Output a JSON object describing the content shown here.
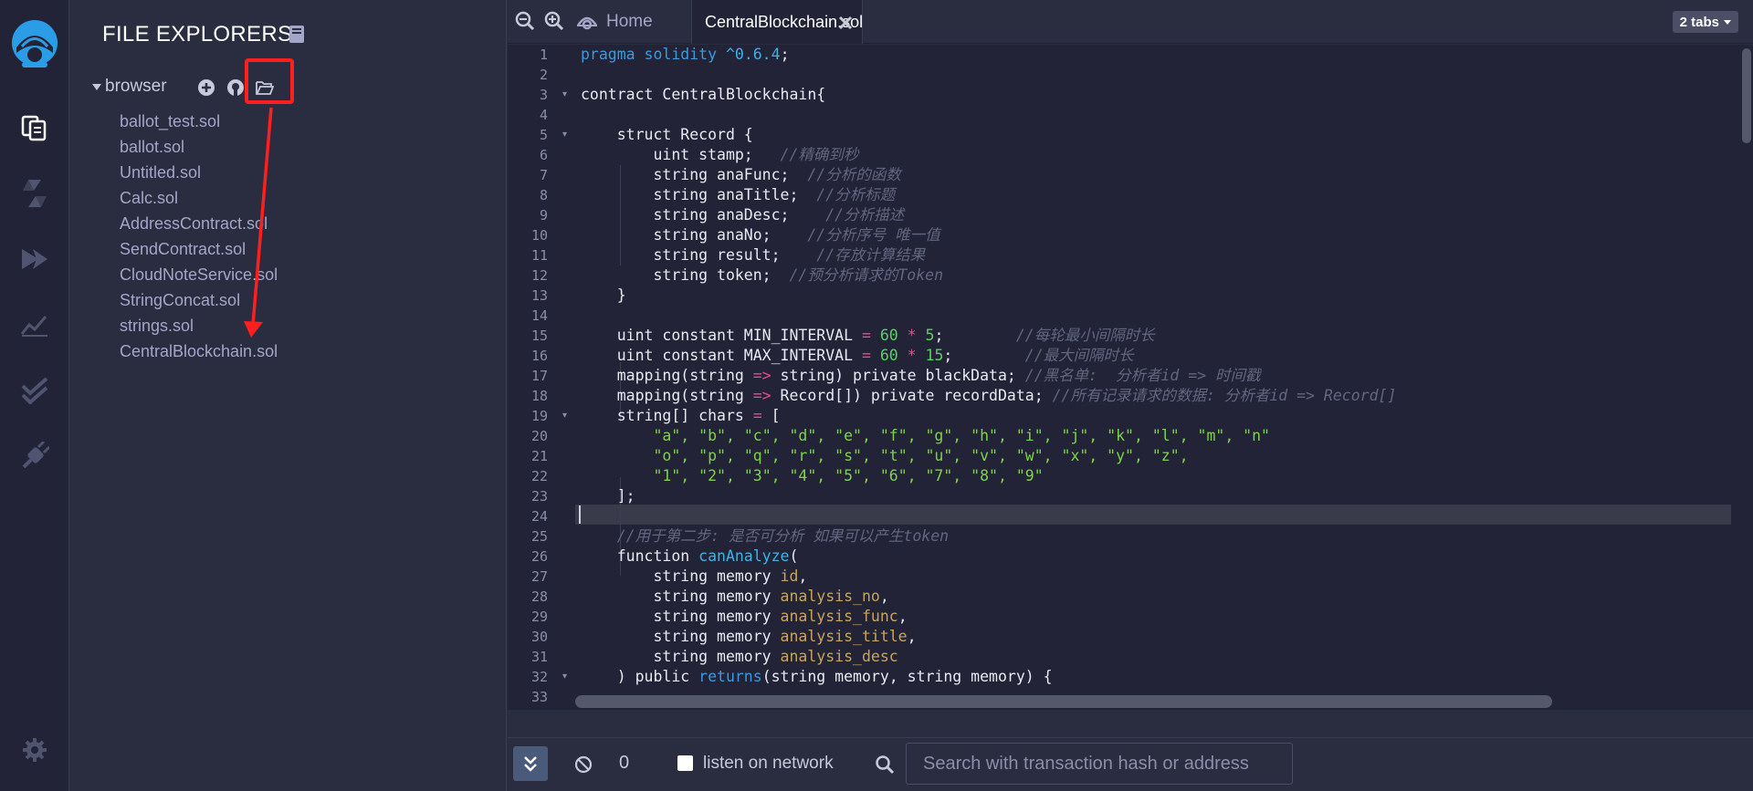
{
  "sidebar": {
    "title": "FILE EXPLORERS",
    "root_folder": "browser",
    "files": [
      "ballot_test.sol",
      "ballot.sol",
      "Untitled.sol",
      "Calc.sol",
      "AddressContract.sol",
      "SendContract.sol",
      "CloudNoteService.sol",
      "StringConcat.sol",
      "strings.sol",
      "CentralBlockchain.sol"
    ]
  },
  "tabs": {
    "home_label": "Home",
    "active_tab": "CentralBlockchain.sol",
    "tabs_count": "2 tabs"
  },
  "editor": {
    "line_numbers": [
      "1",
      "2",
      "3",
      "4",
      "5",
      "6",
      "7",
      "8",
      "9",
      "10",
      "11",
      "12",
      "13",
      "14",
      "15",
      "16",
      "17",
      "18",
      "19",
      "20",
      "21",
      "22",
      "23",
      "24",
      "25",
      "26",
      "27",
      "28",
      "29",
      "30",
      "31",
      "32",
      "33"
    ],
    "code": {
      "l1_kw": "pragma solidity",
      "l1_ver": " ^0.6.4",
      "l1_end": ";",
      "l3": "contract CentralBlockchain{",
      "l5": "    struct Record {",
      "l6_code": "        uint stamp;   ",
      "l6_cmt": "//精确到秒",
      "l7_code": "        string anaFunc;  ",
      "l7_cmt": "//分析的函数",
      "l8_code": "        string anaTitle;  ",
      "l8_cmt": "//分析标题",
      "l9_code": "        string anaDesc;    ",
      "l9_cmt": "//分析描述",
      "l10_code": "        string anaNo;    ",
      "l10_cmt": "//分析序号 唯一值",
      "l11_code": "        string result;    ",
      "l11_cmt": "//存放计算结果",
      "l12_code": "        string token;  ",
      "l12_cmt": "//预分析请求的Token",
      "l13": "    }",
      "l15_a": "    uint constant MIN_INTERVAL ",
      "l15_op1": "=",
      "l15_sp1": " ",
      "l15_n1": "60",
      "l15_sp2": " ",
      "l15_op2": "*",
      "l15_sp3": " ",
      "l15_n2": "5",
      "l15_b": ";        ",
      "l15_cmt": "//每轮最小间隔时长",
      "l16_a": "    uint constant MAX_INTERVAL ",
      "l16_op1": "=",
      "l16_sp1": " ",
      "l16_n1": "60",
      "l16_sp2": " ",
      "l16_op2": "*",
      "l16_sp3": " ",
      "l16_n2": "15",
      "l16_b": ";        ",
      "l16_cmt": "//最大间隔时长",
      "l17_a": "    mapping(string ",
      "l17_op": "=>",
      "l17_b": " string) private blackData; ",
      "l17_cmt": "//黑名单:  分析者id => 时间戳",
      "l18_a": "    mapping(string ",
      "l18_op": "=>",
      "l18_b": " Record[]) private recordData; ",
      "l18_cmt": "//所有记录请求的数据: 分析者id => Record[]",
      "l19_a": "    string[] chars ",
      "l19_op": "=",
      "l19_b": " [",
      "l20_pre": "        ",
      "l20_str": "\"a\", \"b\", \"c\", \"d\", \"e\", \"f\", \"g\", \"h\", \"i\", \"j\", \"k\", \"l\", \"m\", \"n\"",
      "l21_pre": "        ",
      "l21_str": "\"o\", \"p\", \"q\", \"r\", \"s\", \"t\", \"u\", \"v\", \"w\", \"x\", \"y\", \"z\",",
      "l22_pre": "        ",
      "l22_str": "\"1\", \"2\", \"3\", \"4\", \"5\", \"6\", \"7\", \"8\", \"9\"",
      "l23": "    ];",
      "l25_pre": "    ",
      "l25_cmt": "//用于第二步: 是否可分析 如果可以产生token",
      "l26_a": "    function ",
      "l26_fn": "canAnalyze",
      "l26_b": "(",
      "l27_a": "        string memory ",
      "l27_p": "id",
      "l27_b": ",",
      "l28_a": "        string memory ",
      "l28_p": "analysis_no",
      "l28_b": ",",
      "l29_a": "        string memory ",
      "l29_p": "analysis_func",
      "l29_b": ",",
      "l30_a": "        string memory ",
      "l30_p": "analysis_title",
      "l30_b": ",",
      "l31_a": "        string memory ",
      "l31_p": "analysis_desc",
      "l32_a": "    ) public ",
      "l32_kw": "returns",
      "l32_b": "(string memory, string memory) {"
    }
  },
  "terminal": {
    "count": "0",
    "listen_label": "listen on network",
    "search_placeholder": "Search with transaction hash or address"
  },
  "colors": {
    "accent_blue": "#2b9de6",
    "highlight_red": "#ff1f1f",
    "keyword": "#3b9adf",
    "string": "#7ed34a",
    "comment": "#626680"
  },
  "icons": {
    "rail": [
      "remix-logo-icon",
      "file-explorer-icon",
      "solidity-compiler-icon",
      "deploy-run-icon",
      "analysis-icon",
      "verify-icon",
      "plugin-manager-icon",
      "settings-icon"
    ],
    "explorer_actions": [
      "add-file-icon",
      "github-icon",
      "open-folder-icon"
    ]
  }
}
